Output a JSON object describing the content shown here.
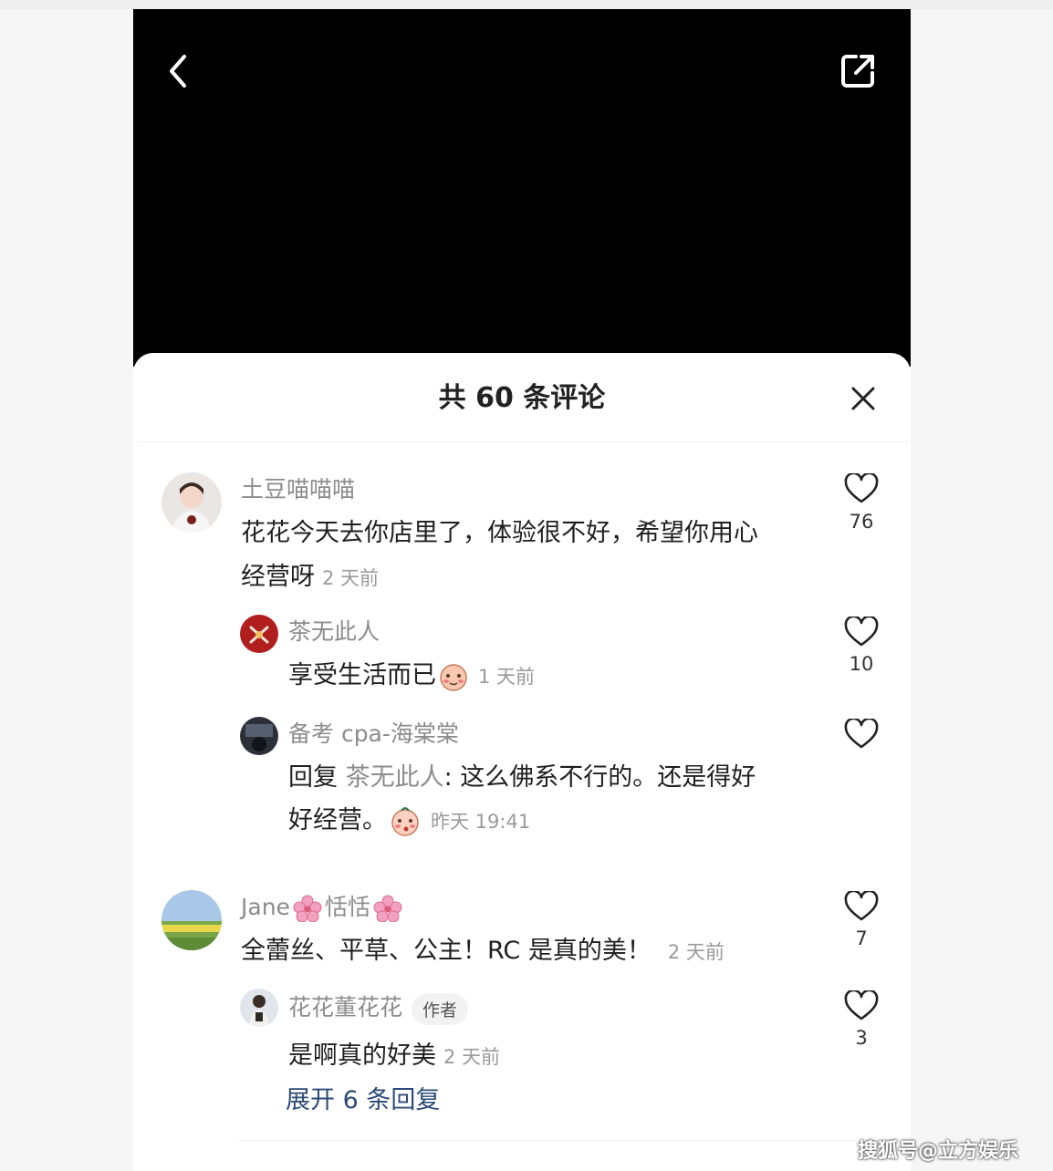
{
  "header": {
    "title": "共 60 条评论"
  },
  "colors": {
    "video_bg": "#000000",
    "sheet_bg": "#ffffff",
    "link": "#2c4a78",
    "muted": "#8c8c8c"
  },
  "icons": {
    "back": "chevron-left-icon",
    "share": "share-icon",
    "close": "close-icon",
    "like": "heart-icon"
  },
  "comments": [
    {
      "user": "土豆喵喵喵",
      "text_line1": "花花今天去你店里了，体验很不好，希望你用心",
      "text_line2": "经营呀",
      "time": "2 天前",
      "likes": "76",
      "replies": [
        {
          "user": "茶无此人",
          "text": "享受生活而已",
          "time": "1 天前",
          "likes": "10"
        },
        {
          "user": "备考 cpa-海棠棠",
          "reply_prefix": "回复 ",
          "reply_to": "茶无此人",
          "text_line1": ": 这么佛系不行的。还是得好",
          "text_line2": "好经营。",
          "time": "昨天 19:41",
          "likes": ""
        }
      ]
    },
    {
      "user_a": "Jane",
      "user_b": "恬恬",
      "text": "全蕾丝、平草、公主！RC 是真的美！",
      "time": "2 天前",
      "likes": "7",
      "replies": [
        {
          "user": "花花董花花",
          "badge": "作者",
          "text": "是啊真的好美",
          "time": "2 天前",
          "likes": "3"
        }
      ]
    }
  ],
  "expand": {
    "label": "展开 6 条回复"
  },
  "watermark": {
    "text": "搜狐号@立方娱乐"
  }
}
